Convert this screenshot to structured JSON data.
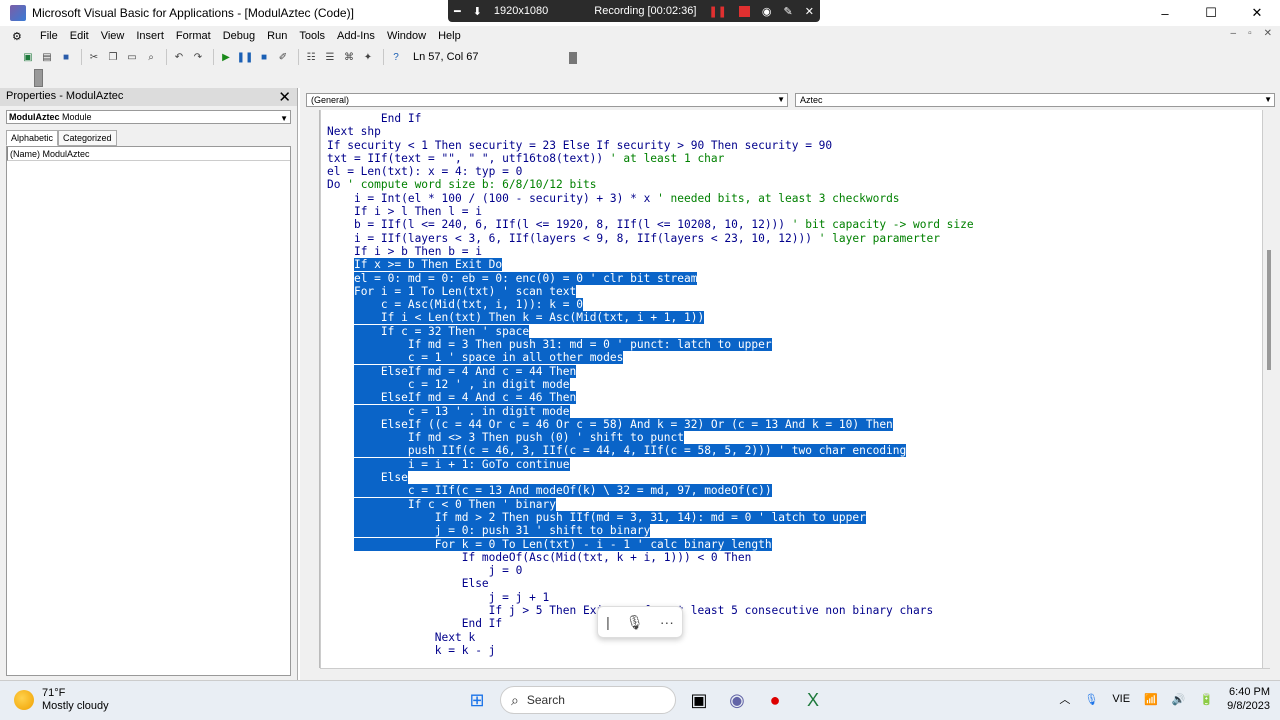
{
  "window": {
    "title": "Microsoft Visual Basic for Applications - [ModulAztec (Code)]",
    "controls": [
      "–",
      "☐",
      "✕"
    ]
  },
  "recording": {
    "resolution": "1920x1080",
    "status": "Recording [00:02:36]"
  },
  "menu": {
    "items": [
      "File",
      "Edit",
      "View",
      "Insert",
      "Format",
      "Debug",
      "Run",
      "Tools",
      "Add-Ins",
      "Window",
      "Help"
    ]
  },
  "toolbar": {
    "position": "Ln 57, Col 67"
  },
  "properties": {
    "title": "Properties - ModulAztec",
    "object_name": "ModulAztec",
    "object_type": "Module",
    "tabs": [
      "Alphabetic",
      "Categorized"
    ],
    "rows": [
      {
        "name": "(Name)",
        "value": "ModulAztec"
      }
    ]
  },
  "code_window": {
    "procedure_combo": "(General)",
    "object_combo": "Aztec",
    "lines": [
      "        End If",
      "Next shp",
      "If security < 1 Then security = 23 Else If security > 90 Then security = 90",
      "txt = IIf(text = \"\", \" \", utf16to8(text)) ' at least 1 char",
      "el = Len(txt): x = 4: typ = 0",
      "Do ' compute word size b: 6/8/10/12 bits",
      "    i = Int(el * 100 / (100 - security) + 3) * x ' needed bits, at least 3 checkwords",
      "    If i > l Then l = i",
      "    b = IIf(l <= 240, 6, IIf(l <= 1920, 8, IIf(l <= 10208, 10, 12))) ' bit capacity -> word size",
      "    i = IIf(layers < 3, 6, IIf(layers < 9, 8, IIf(layers < 23, 10, 12))) ' layer paramerter",
      "    If i > b Then b = i",
      "    If x >= b Then Exit Do",
      "    el = 0: md = 0: eb = 0: enc(0) = 0 ' clr bit stream",
      "    For i = 1 To Len(txt) ' scan text",
      "        c = Asc(Mid(txt, i, 1)): k = 0",
      "        If i < Len(txt) Then k = Asc(Mid(txt, i + 1, 1))",
      "        If c = 32 Then ' space",
      "            If md = 3 Then push 31: md = 0 ' punct: latch to upper",
      "            c = 1 ' space in all other modes",
      "        ElseIf md = 4 And c = 44 Then",
      "            c = 12 ' , in digit mode",
      "        ElseIf md = 4 And c = 46 Then",
      "            c = 13 ' . in digit mode",
      "        ElseIf ((c = 44 Or c = 46 Or c = 58) And k = 32) Or (c = 13 And k = 10) Then",
      "            If md <> 3 Then push (0) ' shift to punct",
      "            push IIf(c = 46, 3, IIf(c = 44, 4, IIf(c = 58, 5, 2))) ' two char encoding",
      "            i = i + 1: GoTo continue",
      "        Else",
      "            c = IIf(c = 13 And modeOf(k) \\ 32 = md, 97, modeOf(c))",
      "            If c < 0 Then ' binary",
      "                If md > 2 Then push IIf(md = 3, 31, 14): md = 0 ' latch to upper",
      "                j = 0: push 31 ' shift to binary",
      "                For k = 0 To Len(txt) - i - 1 ' calc binary length",
      "                    If modeOf(Asc(Mid(txt, k + i, 1))) < 0 Then",
      "                        j = 0",
      "                    Else",
      "                        j = j + 1",
      "                        If j > 5 Then Exi      for at least 5 consecutive non binary chars",
      "                    End If",
      "                Next k",
      "                k = k - j"
    ],
    "selected_from": 11,
    "selected_to": 32
  },
  "voice": {
    "icons": [
      "cursor-icon",
      "mic-icon",
      "more-icon"
    ]
  },
  "taskbar": {
    "weather_temp": "71°F",
    "weather_desc": "Mostly cloudy",
    "search_label": "Search",
    "language": "VIE",
    "time": "6:40 PM",
    "date": "9/8/2023"
  }
}
